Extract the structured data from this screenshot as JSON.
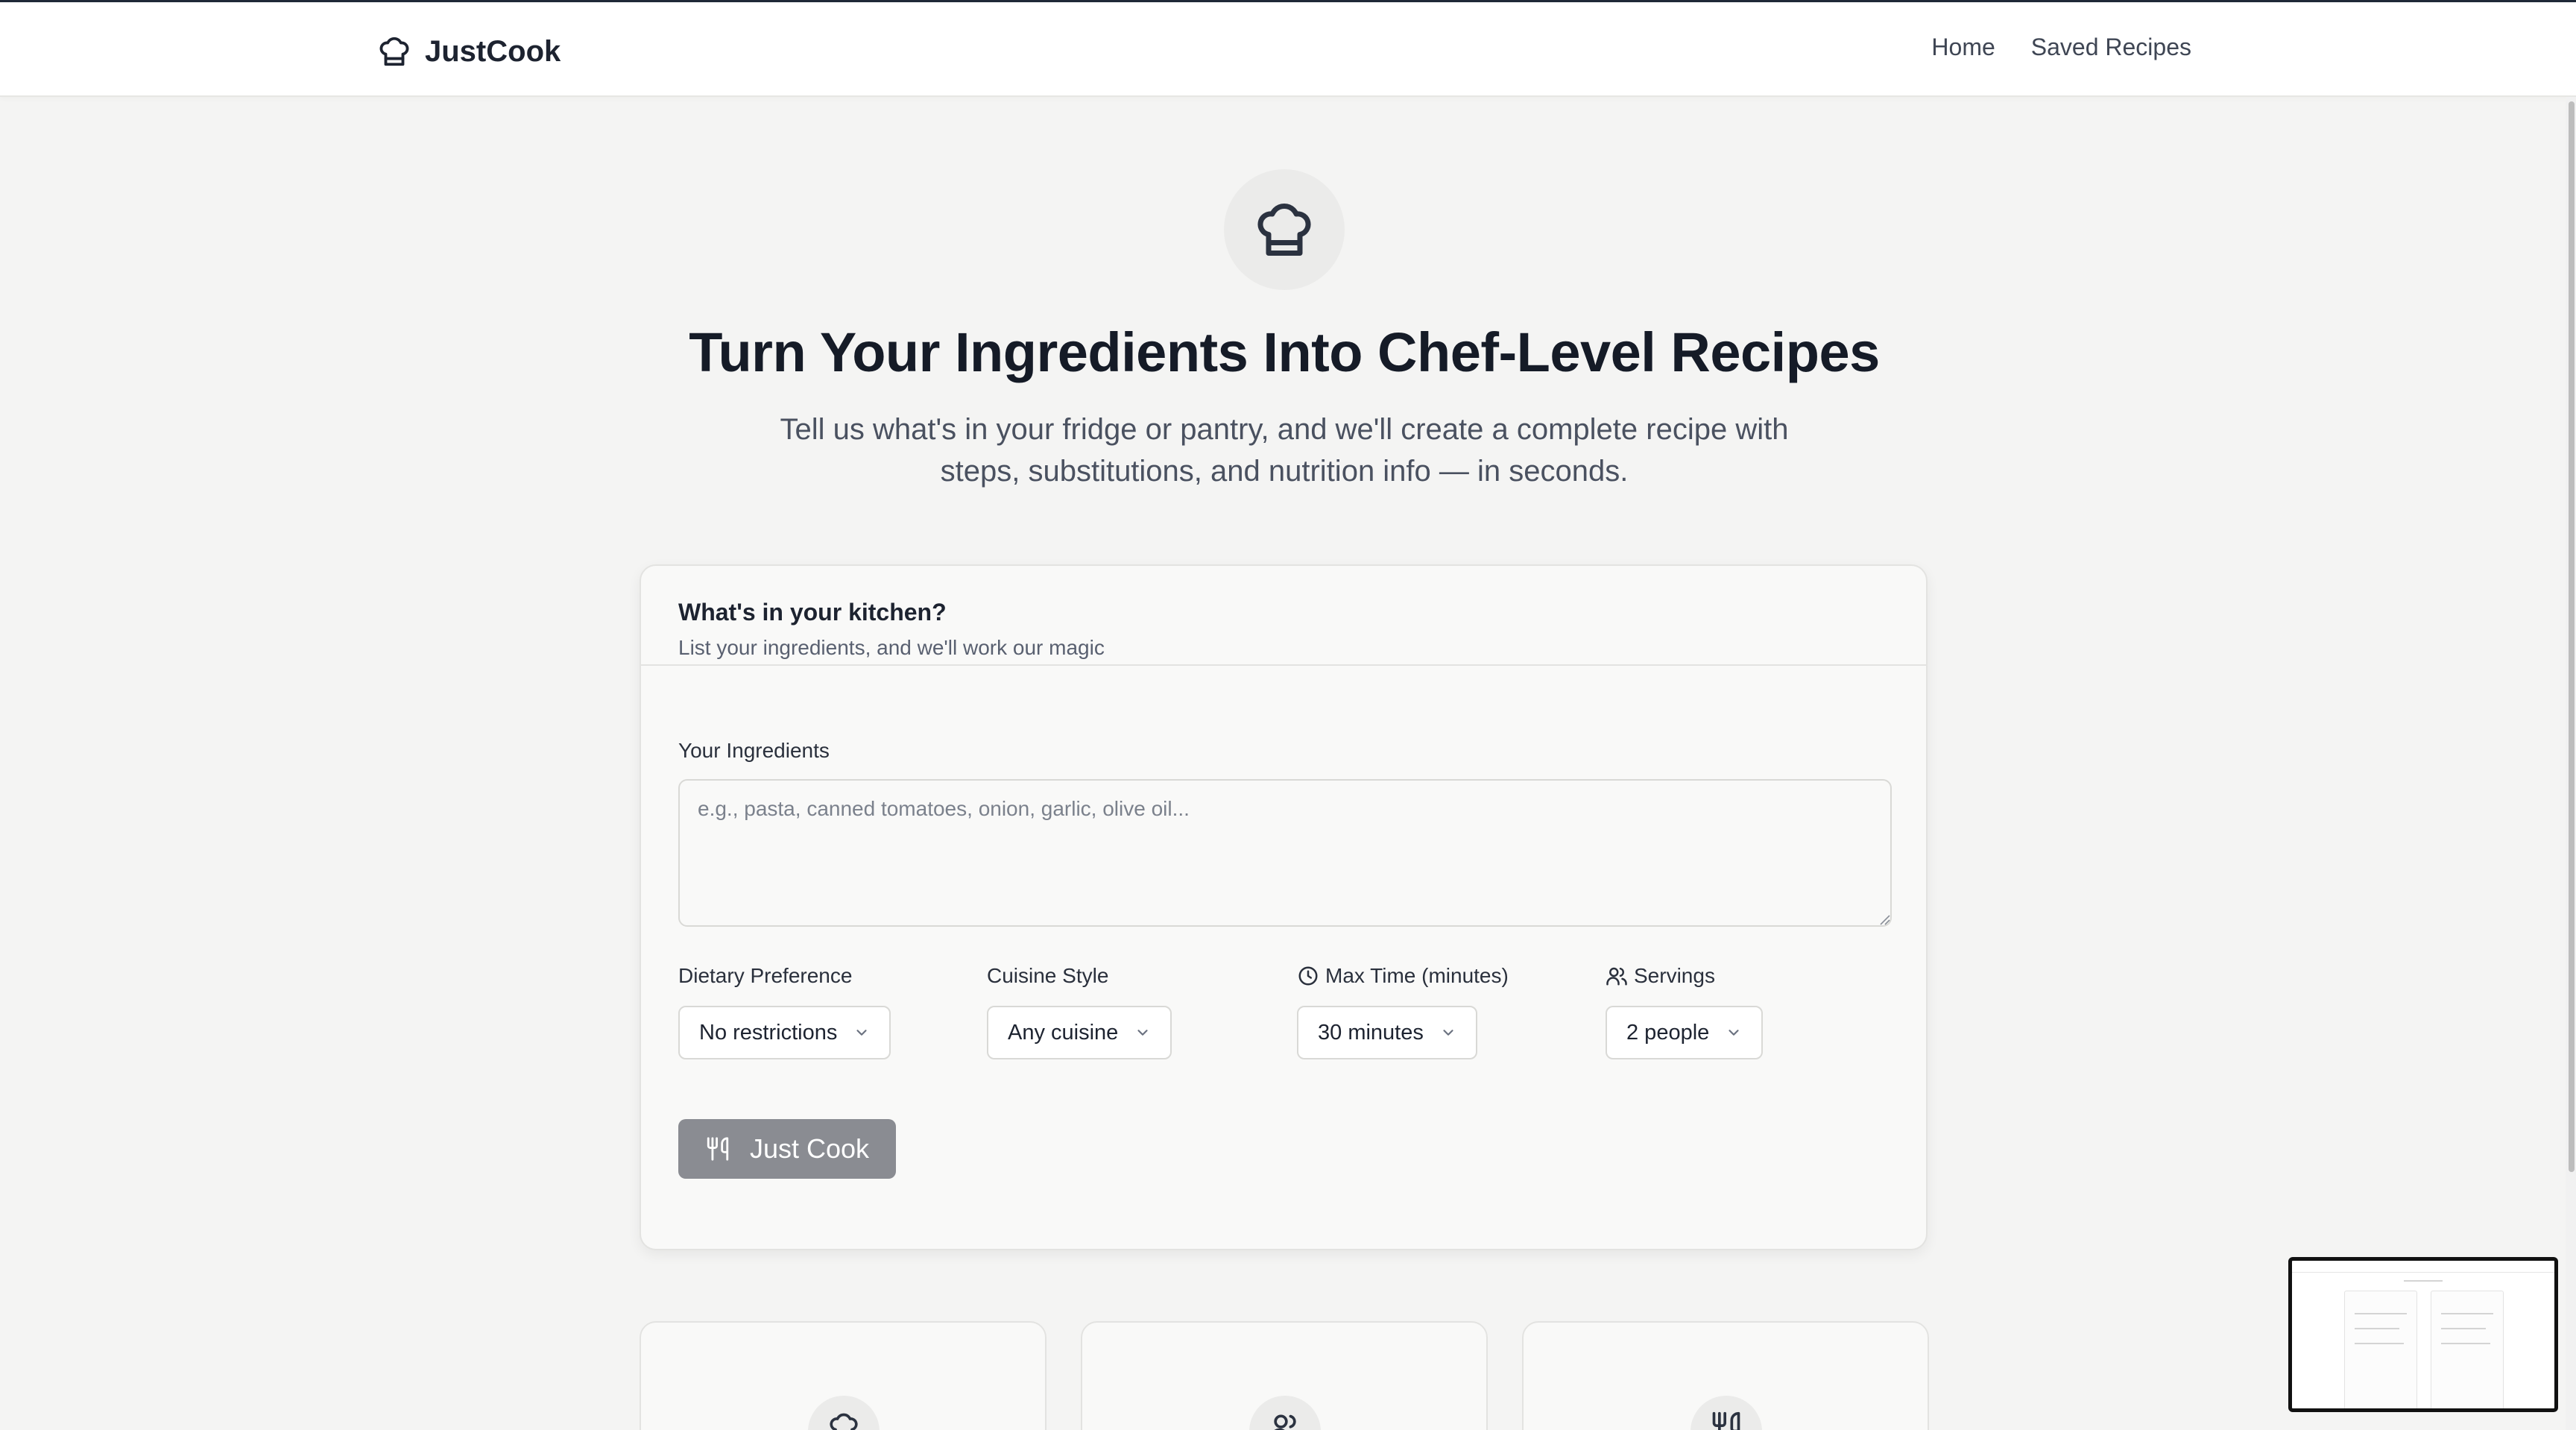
{
  "app": {
    "name": "JustCook"
  },
  "nav": {
    "home": "Home",
    "saved": "Saved Recipes"
  },
  "hero": {
    "title": "Turn Your Ingredients Into Chef-Level Recipes",
    "subtitle": "Tell us what's in your fridge or pantry, and we'll create a complete recipe with steps, substitutions, and nutrition info — in seconds."
  },
  "form": {
    "title": "What's in your kitchen?",
    "description": "List your ingredients, and we'll work our magic",
    "ingredients_label": "Your Ingredients",
    "ingredients_value": "",
    "ingredients_placeholder": "e.g., pasta, canned tomatoes, onion, garlic, olive oil...",
    "dietary_label": "Dietary Preference",
    "dietary_value": "No restrictions",
    "cuisine_label": "Cuisine Style",
    "cuisine_value": "Any cuisine",
    "time_label": "Max Time (minutes)",
    "time_value": "30 minutes",
    "servings_label": "Servings",
    "servings_value": "2 people",
    "submit_label": "Just Cook"
  },
  "features": [
    {
      "icon": "chef-hat-icon"
    },
    {
      "icon": "users-icon"
    },
    {
      "icon": "utensils-icon"
    }
  ],
  "icons": {
    "brand": "chef-hat-icon",
    "hero": "chef-hat-icon",
    "time": "clock-icon",
    "servings": "users-icon",
    "submit": "utensils-icon",
    "dropdown": "chevron-down-icon"
  },
  "colors": {
    "background": "#f4f4f3",
    "text_primary": "#151b27",
    "button_disabled": "#8a8c92"
  }
}
